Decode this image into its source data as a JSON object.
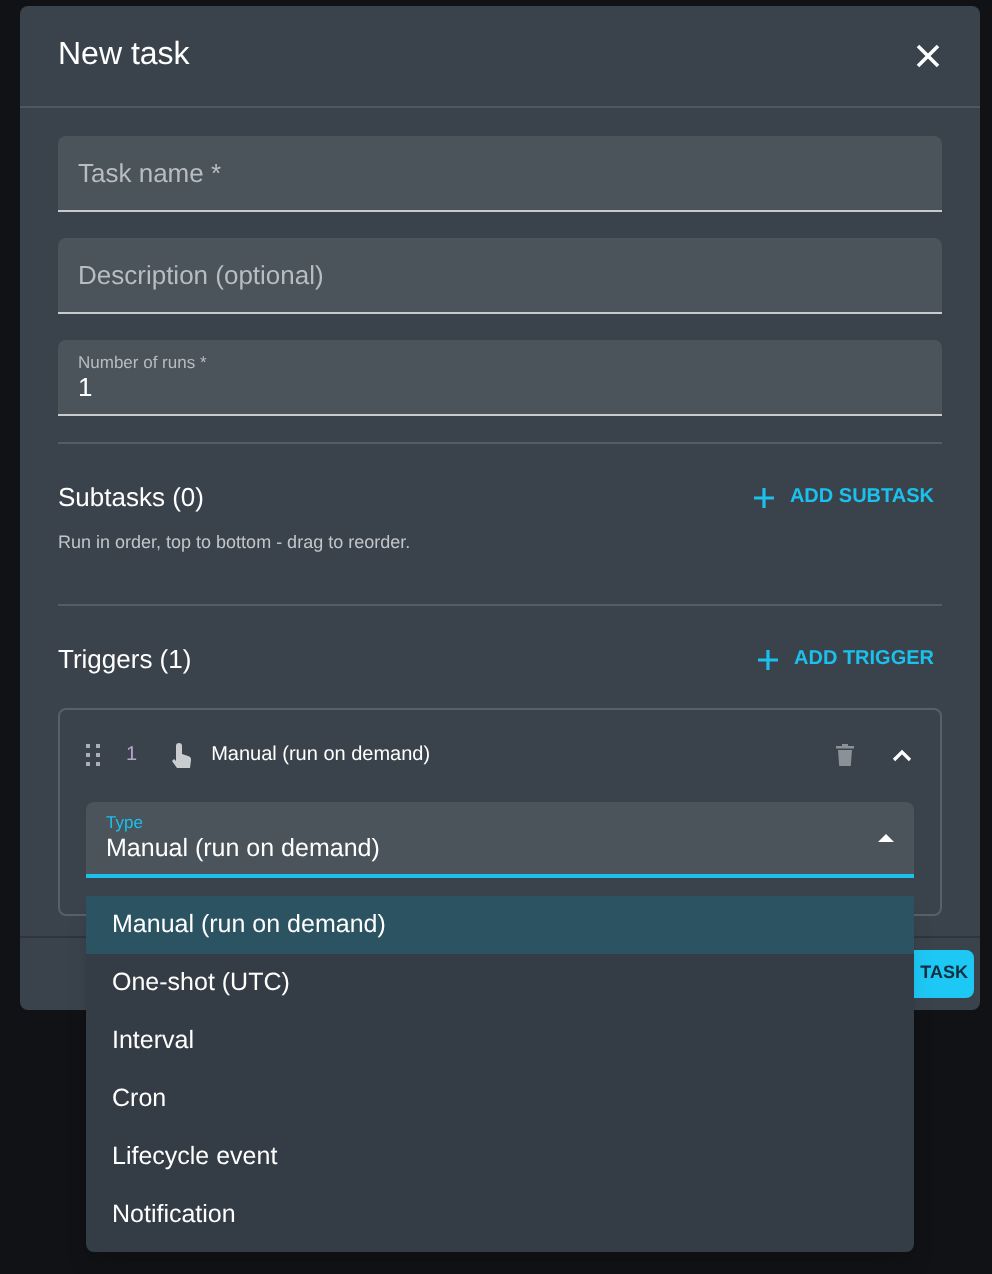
{
  "dialog": {
    "title": "New task"
  },
  "fields": [
    {
      "kind": "placeholder",
      "placeholder": "Task name *"
    },
    {
      "kind": "placeholder",
      "placeholder": "Description (optional)"
    },
    {
      "kind": "filled",
      "label": "Number of runs *",
      "value": "1"
    }
  ],
  "subtasks": {
    "title": "Subtasks (0)",
    "hint": "Run in order, top to bottom - drag to reorder.",
    "add": "ADD SUBTASK"
  },
  "triggers": {
    "title": "Triggers (1)",
    "add": "ADD TRIGGER",
    "items": [
      {
        "index": "1",
        "name": "Manual (run on demand)",
        "expanded": true,
        "type_label": "Type",
        "type_value": "Manual (run on demand)"
      }
    ]
  },
  "dropdown": {
    "options": [
      {
        "label": "Manual (run on demand)",
        "selected": true
      },
      {
        "label": "One-shot (UTC)",
        "selected": false
      },
      {
        "label": "Interval",
        "selected": false
      },
      {
        "label": "Cron",
        "selected": false
      },
      {
        "label": "Lifecycle event",
        "selected": false
      },
      {
        "label": "Notification",
        "selected": false
      }
    ]
  },
  "footer": {
    "submit": "TASK"
  }
}
